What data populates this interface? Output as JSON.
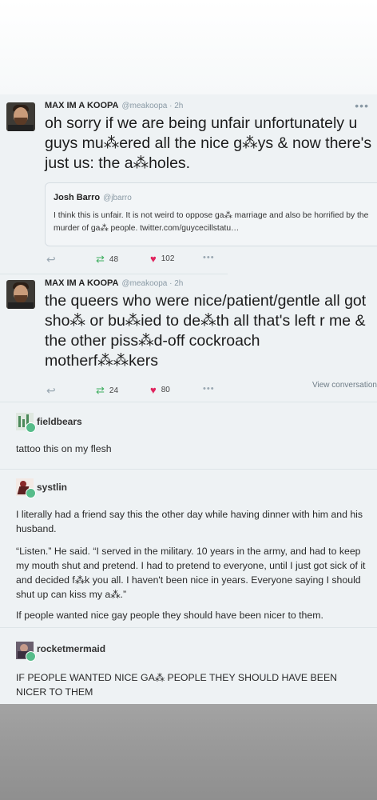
{
  "tweet1": {
    "name": "MAX IM A KOOPA",
    "handle": "@meakoopa · 2h",
    "more": "•••",
    "text": "oh sorry if we are being unfair unfortunately u guys mu⁂ered all the nice g⁂ys & now there's just us: the a⁂holes.",
    "quote": {
      "name": "Josh Barro",
      "handle": "@jbarro",
      "text": "I think this is unfair. It is not weird to oppose ga⁂ marriage and also be horrified by the murder of ga⁂ people. twitter.com/guycecillstatu…"
    },
    "retweets": "48",
    "likes": "102",
    "more_actions": "•••"
  },
  "tweet2": {
    "name": "MAX IM A KOOPA",
    "handle": "@meakoopa · 2h",
    "text": "the queers who were nice/patient/gentle all got sho⁂ or bu⁂ied to de⁂th all that's left r me & the other piss⁂d-off cockroach motherf⁂⁂kers",
    "retweets": "24",
    "likes": "80",
    "more_actions": "•••",
    "view_conversation": "View conversation"
  },
  "reblogs": [
    {
      "username": "fieldbears",
      "paragraphs": [
        "tattoo this on my flesh"
      ]
    },
    {
      "username": "systlin",
      "paragraphs": [
        "I literally had a friend say this the other day while having dinner with him and his husband.",
        "“Listen.” He said. “I served in the military. 10 years in the army, and had to keep my mouth shut and pretend. I had to pretend to everyone, until I just got sick of it and decided f⁂k you all. I haven't been nice in years. Everyone saying I should shut up can kiss my a⁂.”",
        "If people wanted nice gay people they should have been nicer to them."
      ]
    },
    {
      "username": "rocketmermaid",
      "paragraphs": [
        "IF PEOPLE WANTED NICE GA⁂ PEOPLE THEY SHOULD HAVE BEEN NICER TO THEM"
      ]
    }
  ],
  "icons": {
    "reply": "reply-icon",
    "retweet": "retweet-icon",
    "like": "heart-icon",
    "more": "ellipsis-icon"
  },
  "colors": {
    "card_bg": "#eef2f4",
    "retweet": "#3fae5f",
    "like": "#e0245e",
    "muted": "#8a9aa5"
  }
}
